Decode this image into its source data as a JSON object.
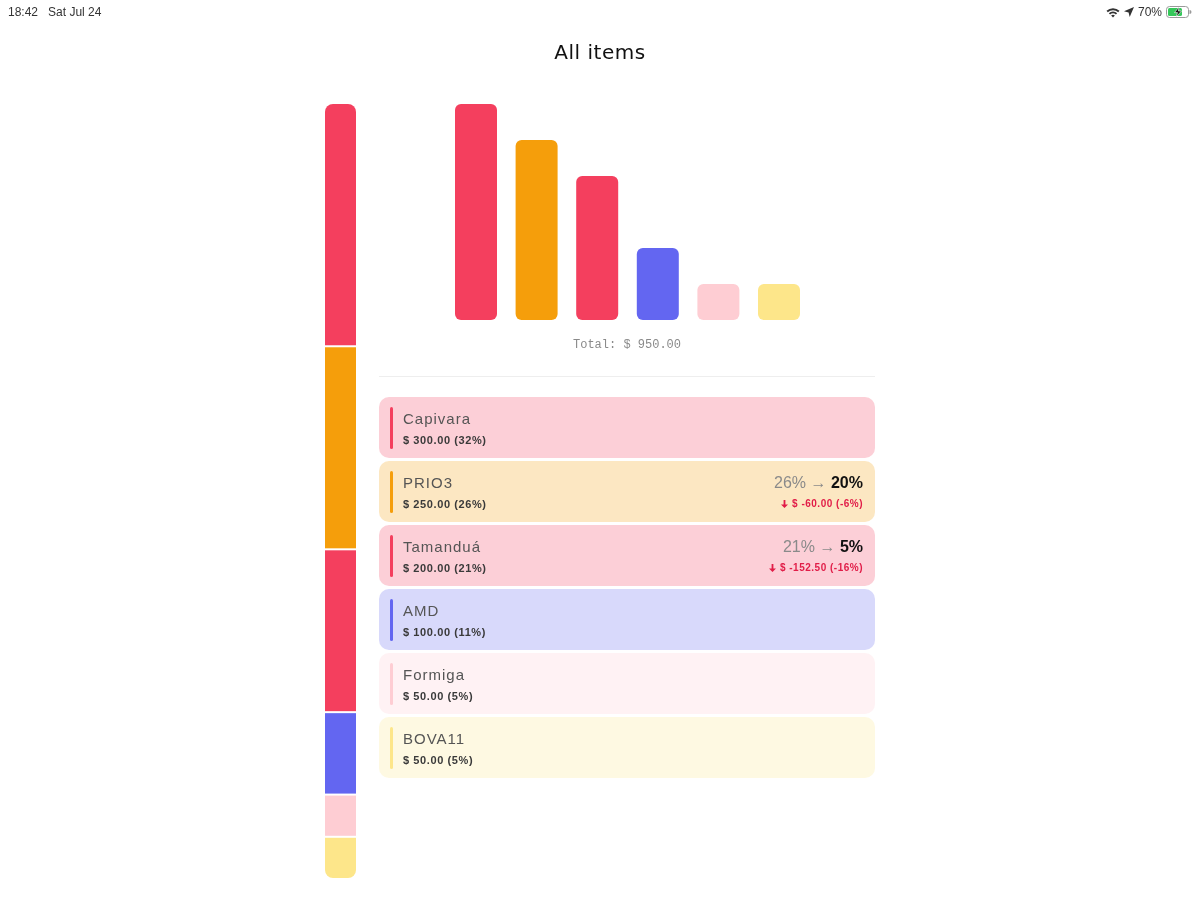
{
  "status_bar": {
    "time": "18:42",
    "date": "Sat Jul 24",
    "battery_percent": "70%",
    "charging": true
  },
  "title": "All items",
  "total": "Total: $ 950.00",
  "items": [
    {
      "name": "Capivara",
      "amount": "$ 300.00 (32%)",
      "color": "#f43f5e"
    },
    {
      "name": "PRIO3",
      "amount": "$ 250.00 (26%)",
      "color": "#f59e0b",
      "allocation": "26% → **20%**",
      "change": "$ -60.00 (-6%)"
    },
    {
      "name": "Tamanduá",
      "amount": "$ 200.00 (21%)",
      "color": "#f43f5e",
      "allocation": "21% → **5%**",
      "change": "$ -152.50 (-16%)"
    },
    {
      "name": "AMD",
      "amount": "$ 100.00 (11%)",
      "color": "#6366f1"
    },
    {
      "name": "Formiga",
      "amount": "$ 50.00 (5%)",
      "color": "#fecdd3"
    },
    {
      "name": "BOVA11",
      "amount": "$ 50.00 (5%)",
      "color": "#fde68a"
    }
  ]
}
